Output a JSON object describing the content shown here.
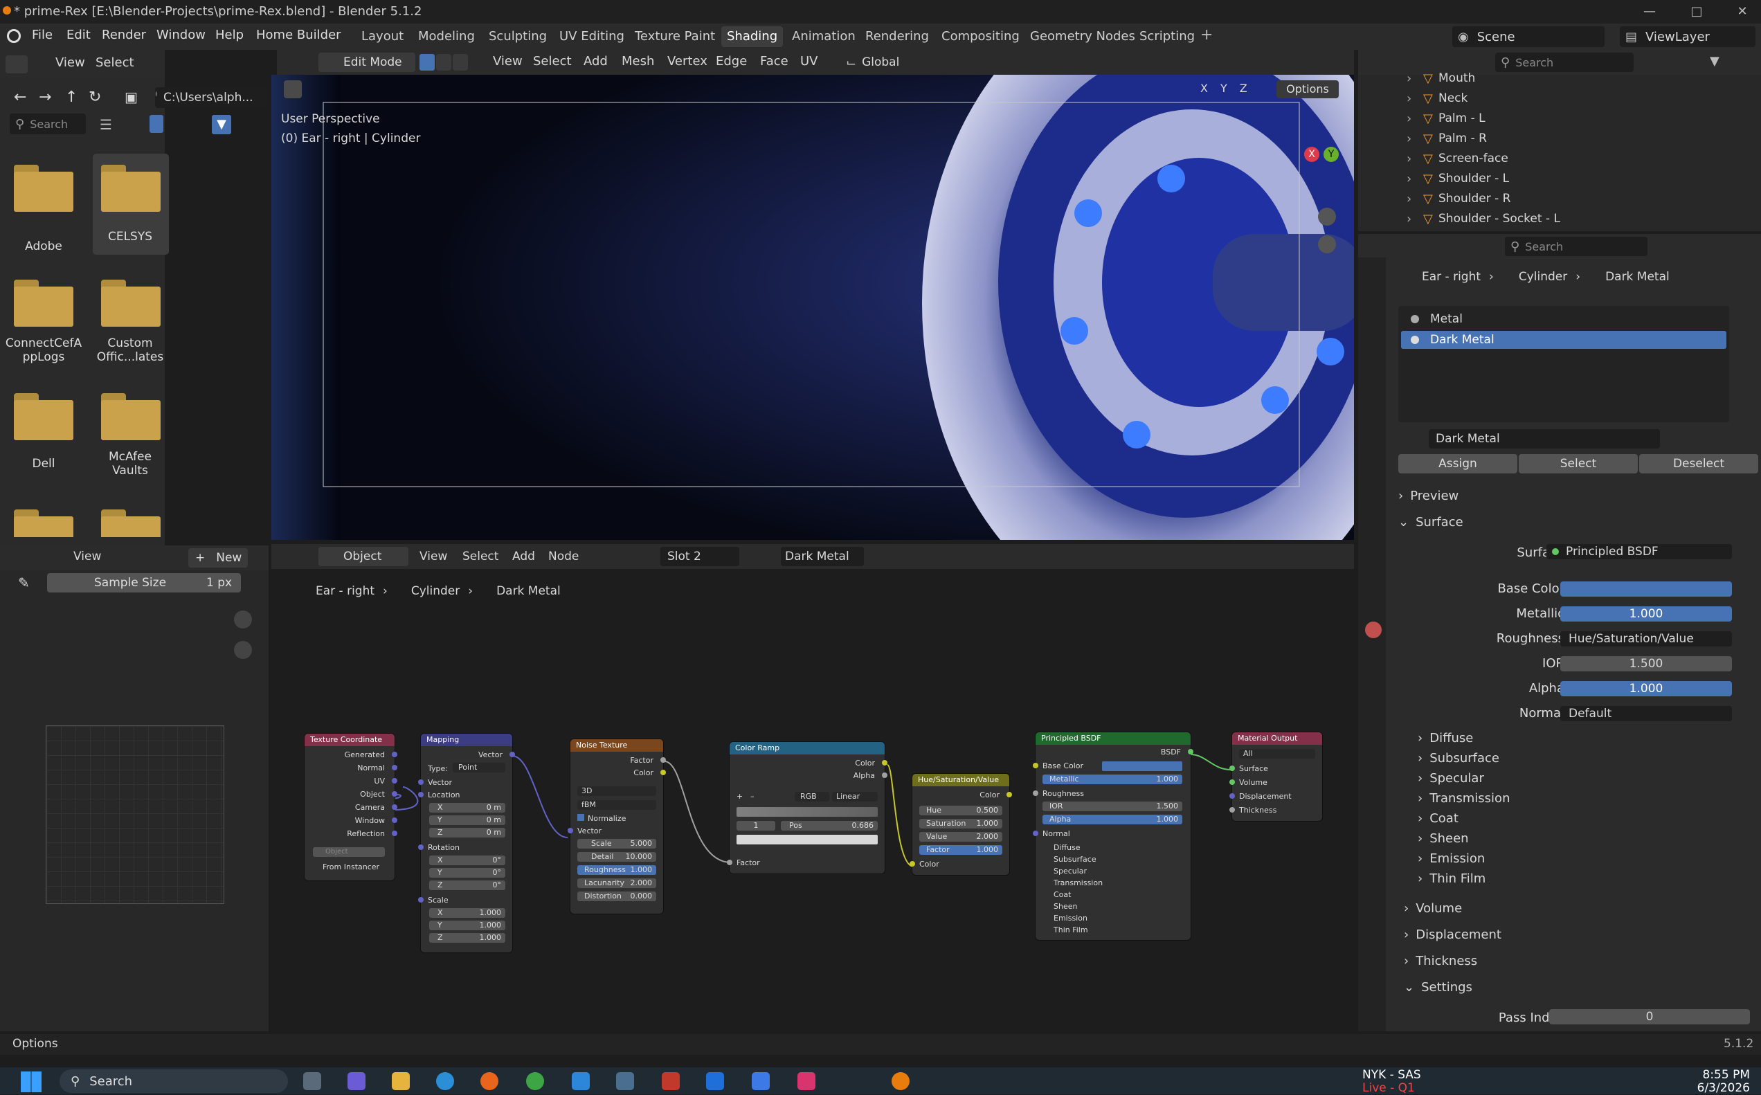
{
  "window": {
    "title": "* prime-Rex [E:\\Blender-Projects\\prime-Rex.blend] - Blender 5.1.2"
  },
  "menubar": {
    "menus": [
      "File",
      "Edit",
      "Render",
      "Window",
      "Help",
      "Home Builder"
    ],
    "workspaces": [
      "Layout",
      "Modeling",
      "Sculpting",
      "UV Editing",
      "Texture Paint",
      "Shading",
      "Animation",
      "Rendering",
      "Compositing",
      "Geometry Nodes",
      "Scripting"
    ],
    "active_workspace": "Shading",
    "scene": "Scene",
    "view_layer": "ViewLayer"
  },
  "file_browser": {
    "menus": [
      "View",
      "Select"
    ],
    "path": "C:\\Users\\alph...",
    "search_placeholder": "Search",
    "folders": [
      "Adobe",
      "CELSYS",
      "ConnectCefA ppLogs",
      "Custom Offic...lates",
      "Dell",
      "McAfee Vaults"
    ]
  },
  "viewport": {
    "mode": "Edit Mode",
    "menus": [
      "View",
      "Select",
      "Add",
      "Mesh",
      "Vertex",
      "Edge",
      "Face",
      "UV"
    ],
    "orientation": "Global",
    "options_label": "Options",
    "overlay_line1": "User Perspective",
    "overlay_line2": "(0) Ear - right | Cylinder",
    "axes": [
      "X",
      "Y",
      "Z"
    ]
  },
  "outliner": {
    "search_placeholder": "Search",
    "items": [
      "Mouth",
      "Neck",
      "Palm - L",
      "Palm - R",
      "Screen-face",
      "Shoulder - L",
      "Shoulder - R",
      "Shoulder - Socket - L"
    ]
  },
  "properties": {
    "search_placeholder": "Search",
    "breadcrumb": [
      "Ear - right",
      "Cylinder",
      "Dark Metal"
    ],
    "slots": [
      "Metal",
      "Dark Metal"
    ],
    "active_slot": "Dark Metal",
    "material_name": "Dark Metal",
    "buttons": [
      "Assign",
      "Select",
      "Deselect"
    ],
    "preview_label": "Preview",
    "surface_label": "Surface",
    "surface_rows": [
      {
        "label": "Surface",
        "value": "Principled BSDF"
      },
      {
        "label": "Base Color",
        "value": ""
      },
      {
        "label": "Metallic",
        "value": "1.000"
      },
      {
        "label": "Roughness",
        "value": "Hue/Saturation/Value"
      },
      {
        "label": "IOR",
        "value": "1.500"
      },
      {
        "label": "Alpha",
        "value": "1.000"
      },
      {
        "label": "Normal",
        "value": "Default"
      }
    ],
    "sub_sections": [
      "Diffuse",
      "Subsurface",
      "Specular",
      "Transmission",
      "Coat",
      "Sheen",
      "Emission",
      "Thin Film"
    ],
    "sections": [
      "Volume",
      "Displacement",
      "Thickness",
      "Settings"
    ],
    "pass_index_label": "Pass Index",
    "pass_index_value": "0"
  },
  "image_editor": {
    "menus": [
      "View"
    ],
    "new_label": "New",
    "sample_size_label": "Sample Size",
    "sample_size_value": "1 px"
  },
  "node_editor": {
    "type": "Object",
    "menus": [
      "View",
      "Select",
      "Add",
      "Node"
    ],
    "slot": "Slot 2",
    "material": "Dark Metal",
    "breadcrumb": [
      "Ear - right",
      "Cylinder",
      "Dark Metal"
    ],
    "nodes": {
      "texcoord": {
        "title": "Texture Coordinate",
        "outputs": [
          "Generated",
          "Normal",
          "UV",
          "Object",
          "Camera",
          "Window",
          "Reflection"
        ],
        "object_placeholder": "Object",
        "from_instancer": "From Instancer"
      },
      "mapping": {
        "title": "Mapping",
        "output": "Vector",
        "type_label": "Type:",
        "type_value": "Point",
        "vector": "Vector",
        "location": "Location",
        "rotation": "Rotation",
        "scale": "Scale",
        "loc": [
          [
            "X",
            "0 m"
          ],
          [
            "Y",
            "0 m"
          ],
          [
            "Z",
            "0 m"
          ]
        ],
        "rot": [
          [
            "X",
            "0°"
          ],
          [
            "Y",
            "0°"
          ],
          [
            "Z",
            "0°"
          ]
        ],
        "scl": [
          [
            "X",
            "1.000"
          ],
          [
            "Y",
            "1.000"
          ],
          [
            "Z",
            "1.000"
          ]
        ]
      },
      "noise": {
        "title": "Noise Texture",
        "outputs": [
          "Factor",
          "Color"
        ],
        "dim": "3D",
        "type": "fBM",
        "normalize": "Normalize",
        "vector": "Vector",
        "fields": [
          [
            "Scale",
            "5.000"
          ],
          [
            "Detail",
            "10.000"
          ],
          [
            "Roughness",
            "1.000"
          ],
          [
            "Lacunarity",
            "2.000"
          ],
          [
            "Distortion",
            "0.000"
          ]
        ]
      },
      "ramp": {
        "title": "Color Ramp",
        "outputs": [
          "Color",
          "Alpha"
        ],
        "mode": "RGB",
        "interp": "Linear",
        "index": "1",
        "pos_label": "Pos",
        "pos": "0.686",
        "input": "Factor"
      },
      "hsv": {
        "title": "Hue/Saturation/Value",
        "output": "Color",
        "fields": [
          [
            "Hue",
            "0.500"
          ],
          [
            "Saturation",
            "1.000"
          ],
          [
            "Value",
            "2.000"
          ],
          [
            "Factor",
            "1.000"
          ]
        ],
        "input": "Color"
      },
      "bsdf": {
        "title": "Principled BSDF",
        "output": "BSDF",
        "rows": [
          "Base Color",
          "Metallic",
          "Roughness",
          "IOR",
          "Alpha",
          "Normal"
        ],
        "metallic": "1.000",
        "ior": "1.500",
        "alpha": "1.000",
        "subs": [
          "Diffuse",
          "Subsurface",
          "Specular",
          "Transmission",
          "Coat",
          "Sheen",
          "Emission",
          "Thin Film"
        ]
      },
      "output": {
        "title": "Material Output",
        "target": "All",
        "inputs": [
          "Surface",
          "Volume",
          "Displacement",
          "Thickness"
        ]
      }
    }
  },
  "statusbar": {
    "left": "Options",
    "version": "5.1.2"
  },
  "taskbar": {
    "search": "Search",
    "news_line1": "NYK - SAS",
    "news_line2": "Live - Q1",
    "time": "8:55 PM",
    "date": "6/3/2026"
  },
  "colors": {
    "accent": "#4772b3",
    "socket_purple": "#6363c7",
    "socket_yellow": "#c7c729",
    "socket_green": "#63c763"
  }
}
